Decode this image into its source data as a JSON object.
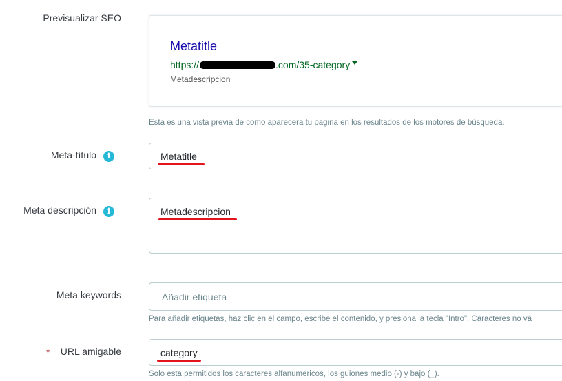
{
  "seo_preview": {
    "label": "Previsualizar SEO",
    "title": "Metatitle",
    "url_prefix": "https://",
    "url_suffix": ".com/35-category",
    "description": "Metadescripcion",
    "help": "Esta es una vista previa de como aparecera tu pagina en los resultados de los motores de búsqueda."
  },
  "meta_title": {
    "label": "Meta-título",
    "value": "Metatitle"
  },
  "meta_description": {
    "label": "Meta descripción",
    "value": "Metadescripcion"
  },
  "meta_keywords": {
    "label": "Meta keywords",
    "placeholder": "Añadir etiqueta",
    "help": "Para añadir etiquetas, haz clic en el campo, escribe el contenido, y presiona la tecla \"Intro\". Caracteres no vá"
  },
  "friendly_url": {
    "required_mark": "*",
    "label": "URL amigable",
    "value": "category",
    "help": "Solo esta permitidos los caracteres alfanumericos, los guiones medio (-) y bajo (_)."
  },
  "icons": {
    "info_glyph": "i",
    "info_icon": "info-icon",
    "url_caret": "caret-down-icon"
  },
  "colors": {
    "accent": "#25b9d7",
    "link_title": "#1a0dab",
    "url_green": "#006621",
    "annotation_red": "#e2141b"
  }
}
